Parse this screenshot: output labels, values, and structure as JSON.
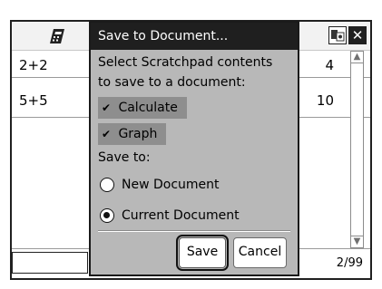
{
  "app": {
    "calculator_icon": "calculator-icon",
    "toolbar_icons": [
      "settings-icon",
      "close-icon"
    ],
    "close_glyph": "✕"
  },
  "history": {
    "rows": [
      {
        "expression": "2+2",
        "result": "4"
      },
      {
        "expression": "5+5",
        "result": "10"
      }
    ]
  },
  "status": {
    "page_count": "2/99"
  },
  "dialog": {
    "title": "Save to Document...",
    "instruction_line1": "Select Scratchpad contents",
    "instruction_line2": "to save to a document:",
    "check_items": [
      {
        "label": "Calculate",
        "checked": true
      },
      {
        "label": "Graph",
        "checked": true
      }
    ],
    "check_glyph": "✔",
    "save_to_label": "Save to:",
    "options": [
      {
        "label": "New Document",
        "selected": false
      },
      {
        "label": "Current Document",
        "selected": true
      }
    ],
    "save_button": "Save",
    "cancel_button": "Cancel"
  },
  "colors": {
    "title_bar": "#1f1f1f",
    "dialog_bg": "#b8b8b8",
    "selected_item_bg": "#8e8e8e"
  }
}
